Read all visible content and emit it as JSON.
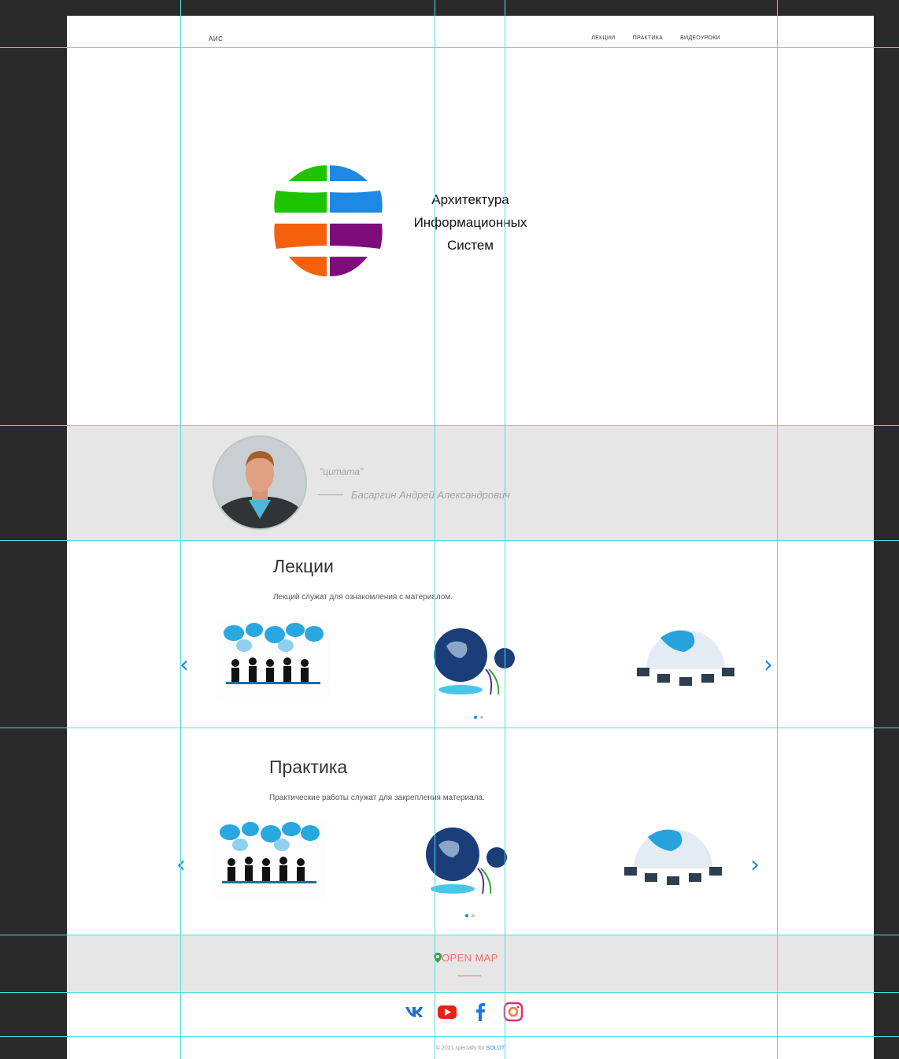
{
  "header": {
    "brand": "АИС",
    "nav": [
      "ЛЕКЦИИ",
      "ПРАКТИКА",
      "ВИДЕОУРОКИ"
    ]
  },
  "hero": {
    "title_lines": [
      "Архитектура",
      "Информационных",
      "Систем"
    ],
    "logo_colors": [
      "#1fc400",
      "#1e88e5",
      "#f4600c",
      "#7e0c7a"
    ]
  },
  "quote": {
    "text": "\"цитата\"",
    "author": "Басаргин Андрей Александрович"
  },
  "lectures": {
    "title": "Лекции",
    "description": "Лекций служат для ознакомления с материалом.",
    "slides": [
      "people-speech-bubbles-image",
      "globe-network-image",
      "earth-computers-image"
    ],
    "active_dot": 1,
    "dot_count": 2
  },
  "practice": {
    "title": "Практика",
    "description": "Практические работы служат для закрепления материала.",
    "slides": [
      "people-speech-bubbles-image",
      "globe-network-image",
      "earth-computers-image"
    ],
    "active_dot": 1,
    "dot_count": 2
  },
  "map": {
    "label": "OPEN MAP",
    "color": "#f36d6d"
  },
  "social": [
    "vk-icon",
    "youtube-icon",
    "facebook-icon",
    "instagram-icon"
  ],
  "footer": {
    "text": "© 2021 specially for ",
    "accent": "SOLOT"
  },
  "colors": {
    "accent": "#1e88e5",
    "band": "#e6e6e6",
    "guides": "#4fdfe0",
    "outer_bg": "#2a2a2a"
  }
}
